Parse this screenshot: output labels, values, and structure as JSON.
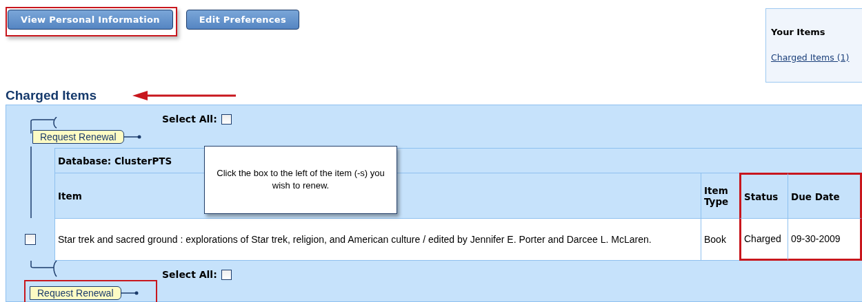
{
  "nav_buttons": [
    {
      "label": "View Personal Information",
      "highlighted": true
    },
    {
      "label": "Edit Preferences",
      "highlighted": false
    }
  ],
  "sidebar": {
    "title": "Your Items",
    "links": [
      "Charged Items (1)"
    ]
  },
  "heading": "Charged Items",
  "select_all_top": {
    "label": "Select All:",
    "checked": false
  },
  "renew_top": {
    "label": "Request Renewal",
    "highlighted": false
  },
  "database": {
    "label": "Database:",
    "value": "ClusterPTS"
  },
  "columns": [
    {
      "label": "Item",
      "highlighted": false
    },
    {
      "label": "Item Type",
      "highlighted": false
    },
    {
      "label": "Status",
      "highlighted": true
    },
    {
      "label": "Due Date",
      "highlighted": true
    }
  ],
  "rows": [
    {
      "checked": false,
      "cells": [
        "Star trek and sacred ground : explorations of Star trek, religion, and American culture / edited by Jennifer E. Porter and Darcee L. McLaren.",
        "Book",
        "Charged",
        "09-30-2009"
      ]
    }
  ],
  "select_all_bottom": {
    "label": "Select All:",
    "checked": false
  },
  "renew_bottom": {
    "label": "Request Renewal",
    "highlighted": true
  },
  "callout": "Click the box to the left of the item (-s) you wish to renew."
}
